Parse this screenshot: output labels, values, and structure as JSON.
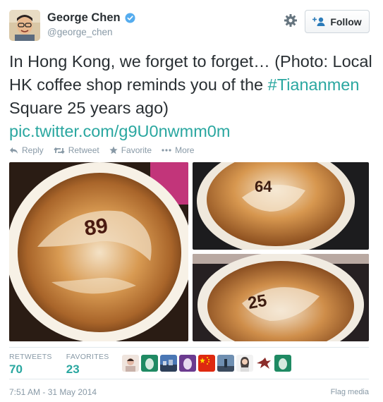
{
  "author": {
    "display_name": "George Chen",
    "handle": "@george_chen",
    "verified": true,
    "avatar_icon": "user-avatar"
  },
  "follow": {
    "label": "Follow",
    "icon": "follow-user-icon"
  },
  "tweet": {
    "text_before": "In Hong Kong, we forget to forget… (Photo: Local HK coffee shop reminds you of the ",
    "hashtag": "#Tiananmen",
    "text_after": " Square 25 years ago)",
    "link": "pic.twitter.com/g9U0nwmm0m"
  },
  "actions": [
    {
      "label": "Reply",
      "icon": "reply-icon"
    },
    {
      "label": "Retweet",
      "icon": "retweet-icon"
    },
    {
      "label": "Favorite",
      "icon": "star-icon"
    },
    {
      "label": "More",
      "icon": "more-dots-icon"
    }
  ],
  "photos": [
    {
      "number": "89"
    },
    {
      "number": "64"
    },
    {
      "number": "25"
    }
  ],
  "stats": {
    "retweets_label": "RETWEETS",
    "retweets_value": "70",
    "favorites_label": "FAVORITES",
    "favorites_value": "23"
  },
  "timestamp": "7:51 AM - 31 May 2014",
  "flag_label": "Flag media",
  "colors": {
    "link": "#2aa7a0",
    "muted": "#8899a6",
    "verified": "#55acee"
  }
}
